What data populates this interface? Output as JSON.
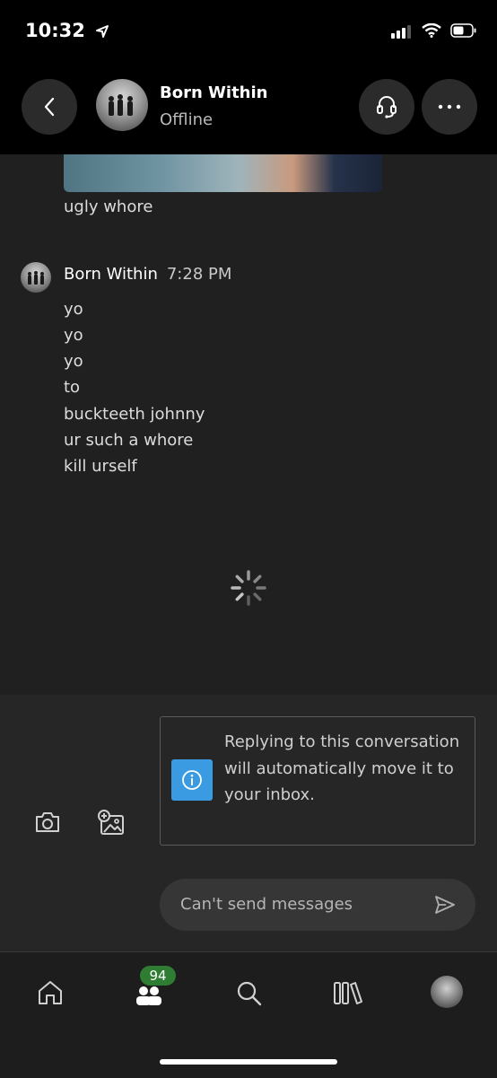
{
  "status_bar": {
    "time": "10:32"
  },
  "header": {
    "contact_name": "Born Within",
    "contact_status": "Offline"
  },
  "chat": {
    "caption_message": "ugly whore",
    "sender": "Born Within",
    "timestamp": "7:28 PM",
    "messages": [
      "yo",
      "yo",
      "yo",
      "to",
      "buckteeth johnny",
      "ur such a whore",
      "kill urself"
    ]
  },
  "notice": {
    "text": "Replying to this conversation will automatically move it to your inbox."
  },
  "composer": {
    "placeholder": "Can't send messages"
  },
  "nav": {
    "badge_count": "94"
  },
  "colors": {
    "background": "#202020",
    "info_accent": "#3a9be2",
    "badge_green": "#2f7d32"
  }
}
